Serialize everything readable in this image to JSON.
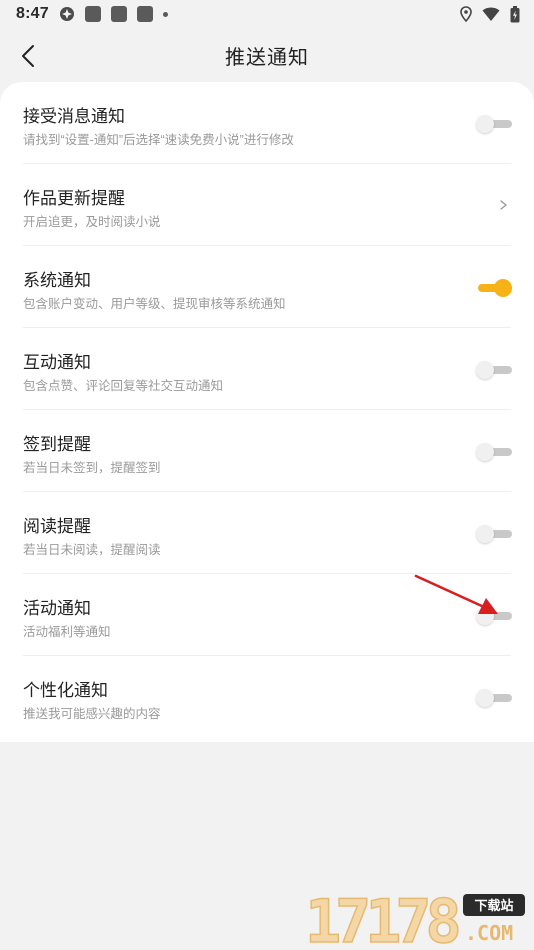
{
  "status_bar": {
    "time": "8:47"
  },
  "header": {
    "title": "推送通知"
  },
  "settings": [
    {
      "title": "接受消息通知",
      "desc": "请找到“设置-通知”后选择“速读免费小说”进行修改",
      "control": "toggle",
      "on": false
    },
    {
      "title": "作品更新提醒",
      "desc": "开启追更，及时阅读小说",
      "control": "chevron"
    },
    {
      "title": "系统通知",
      "desc": "包含账户变动、用户等级、提现审核等系统通知",
      "control": "toggle",
      "on": true
    },
    {
      "title": "互动通知",
      "desc": "包含点赞、评论回复等社交互动通知",
      "control": "toggle",
      "on": false
    },
    {
      "title": "签到提醒",
      "desc": "若当日未签到，提醒签到",
      "control": "toggle",
      "on": false
    },
    {
      "title": "阅读提醒",
      "desc": "若当日未阅读，提醒阅读",
      "control": "toggle",
      "on": false
    },
    {
      "title": "活动通知",
      "desc": "活动福利等通知",
      "control": "toggle",
      "on": false
    },
    {
      "title": "个性化通知",
      "desc": "推送我可能感兴趣的内容",
      "control": "toggle",
      "on": false
    }
  ],
  "colors": {
    "accent": "#f7b216",
    "annotation": "#e02020",
    "background": "#f2f2f2"
  },
  "watermark": {
    "text": "17178",
    "badge": "下载站",
    "domain": ".COM"
  }
}
